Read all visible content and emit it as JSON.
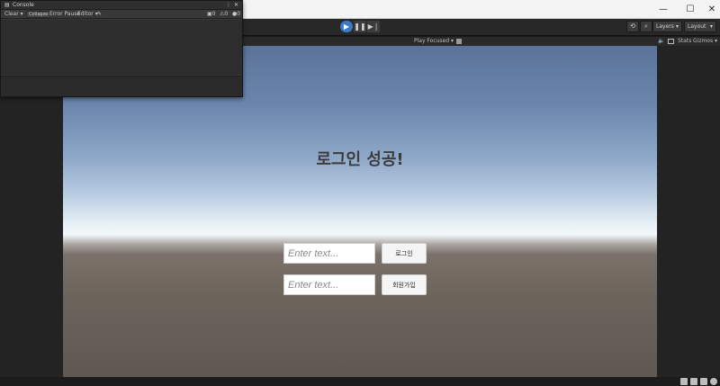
{
  "window": {
    "minimize": "—",
    "maximize": "☐",
    "close": "✕"
  },
  "toolbar": {
    "play": "▶",
    "pause": "❚❚",
    "step": "▶❘",
    "history_icon": "history-icon",
    "search_icon": "search-icon",
    "layers": "Layers",
    "layout": "Layout"
  },
  "game_bar": {
    "play_mode": "Play Focused",
    "stats": "Stats",
    "gizmos": "Gizmos"
  },
  "console": {
    "title": "Console",
    "clear": "Clear",
    "collapse": "Collapse",
    "error_pause": "Error Pause",
    "editor": "Editor",
    "log_count": "0",
    "warning_count": "0",
    "error_count": "0"
  },
  "game": {
    "title": "로그인 성공!",
    "input1_placeholder": "Enter text...",
    "input2_placeholder": "Enter text...",
    "login_button": "로그인",
    "signup_button": "회원가입"
  },
  "colors": {
    "editor_bg": "#282828",
    "panel_bg": "#383838",
    "play_active": "#3a79c4"
  }
}
